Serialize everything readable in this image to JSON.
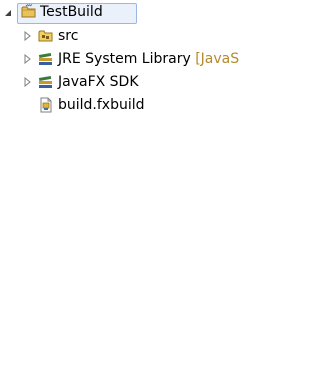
{
  "tree": {
    "root": {
      "label": "TestBuild",
      "icon": "folder-project-icon"
    },
    "children": [
      {
        "label": "src",
        "icon": "package-folder-icon"
      },
      {
        "label": "JRE System Library",
        "decoration": "[JavaS",
        "icon": "library-icon"
      },
      {
        "label": "JavaFX SDK",
        "icon": "library-icon"
      },
      {
        "label": "build.fxbuild",
        "icon": "fxbuild-file-icon"
      }
    ]
  }
}
